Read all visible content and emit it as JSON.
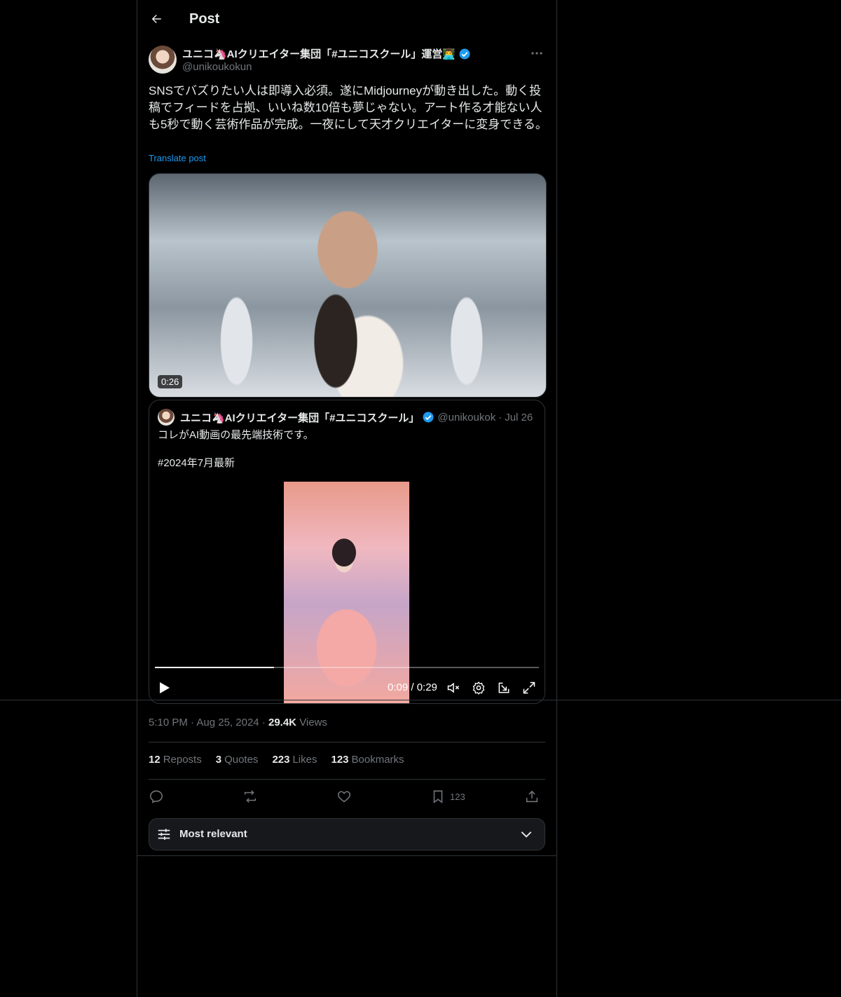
{
  "header": {
    "title": "Post"
  },
  "author": {
    "name": "ユニコ🦄AIクリエイター集団「#ユニコスクール」運営👨‍💻",
    "handle": "@unikoukokun"
  },
  "post": {
    "text": "SNSでバズりたい人は即導入必須。遂にMidjourneyが動き出した。動く投稿でフィードを占拠、いいね数10倍も夢じゃない。アート作る才能ない人も5秒で動く芸術作品が完成。一夜にして天才クリエイターに変身できる。",
    "translate_label": "Translate post",
    "video_duration": "0:26"
  },
  "quote": {
    "name": "ユニコ🦄AIクリエイター集団「#ユニコスクール」",
    "handle": "@unikoukok",
    "dot": "·",
    "date": "Jul 26",
    "text": "コレがAI動画の最先端技術です。\n\n#2024年7月最新",
    "time_display": "0:09 / 0:29",
    "progress": 0.31
  },
  "meta": {
    "time": "5:10 PM",
    "sep1": "·",
    "date": "Aug 25, 2024",
    "sep2": "·",
    "views_count": "29.4K",
    "views_label": "Views"
  },
  "stats": [
    {
      "count": "12",
      "label": "Reposts"
    },
    {
      "count": "3",
      "label": "Quotes"
    },
    {
      "count": "223",
      "label": "Likes"
    },
    {
      "count": "123",
      "label": "Bookmarks"
    }
  ],
  "actions": {
    "bookmark_count": "123"
  },
  "sort": {
    "label": "Most relevant"
  },
  "colors": {
    "accent": "#1d9bf0",
    "text": "#e7e9ea",
    "muted": "#71767b",
    "border": "#2f3336",
    "background": "#000000"
  },
  "icons": [
    "back-arrow-icon",
    "more-icon",
    "verified-icon",
    "play-icon",
    "mute-icon",
    "settings-icon",
    "pip-icon",
    "fullscreen-icon",
    "reply-icon",
    "repost-icon",
    "like-icon",
    "bookmark-icon",
    "share-icon",
    "sort-icon",
    "chevron-down-icon"
  ]
}
